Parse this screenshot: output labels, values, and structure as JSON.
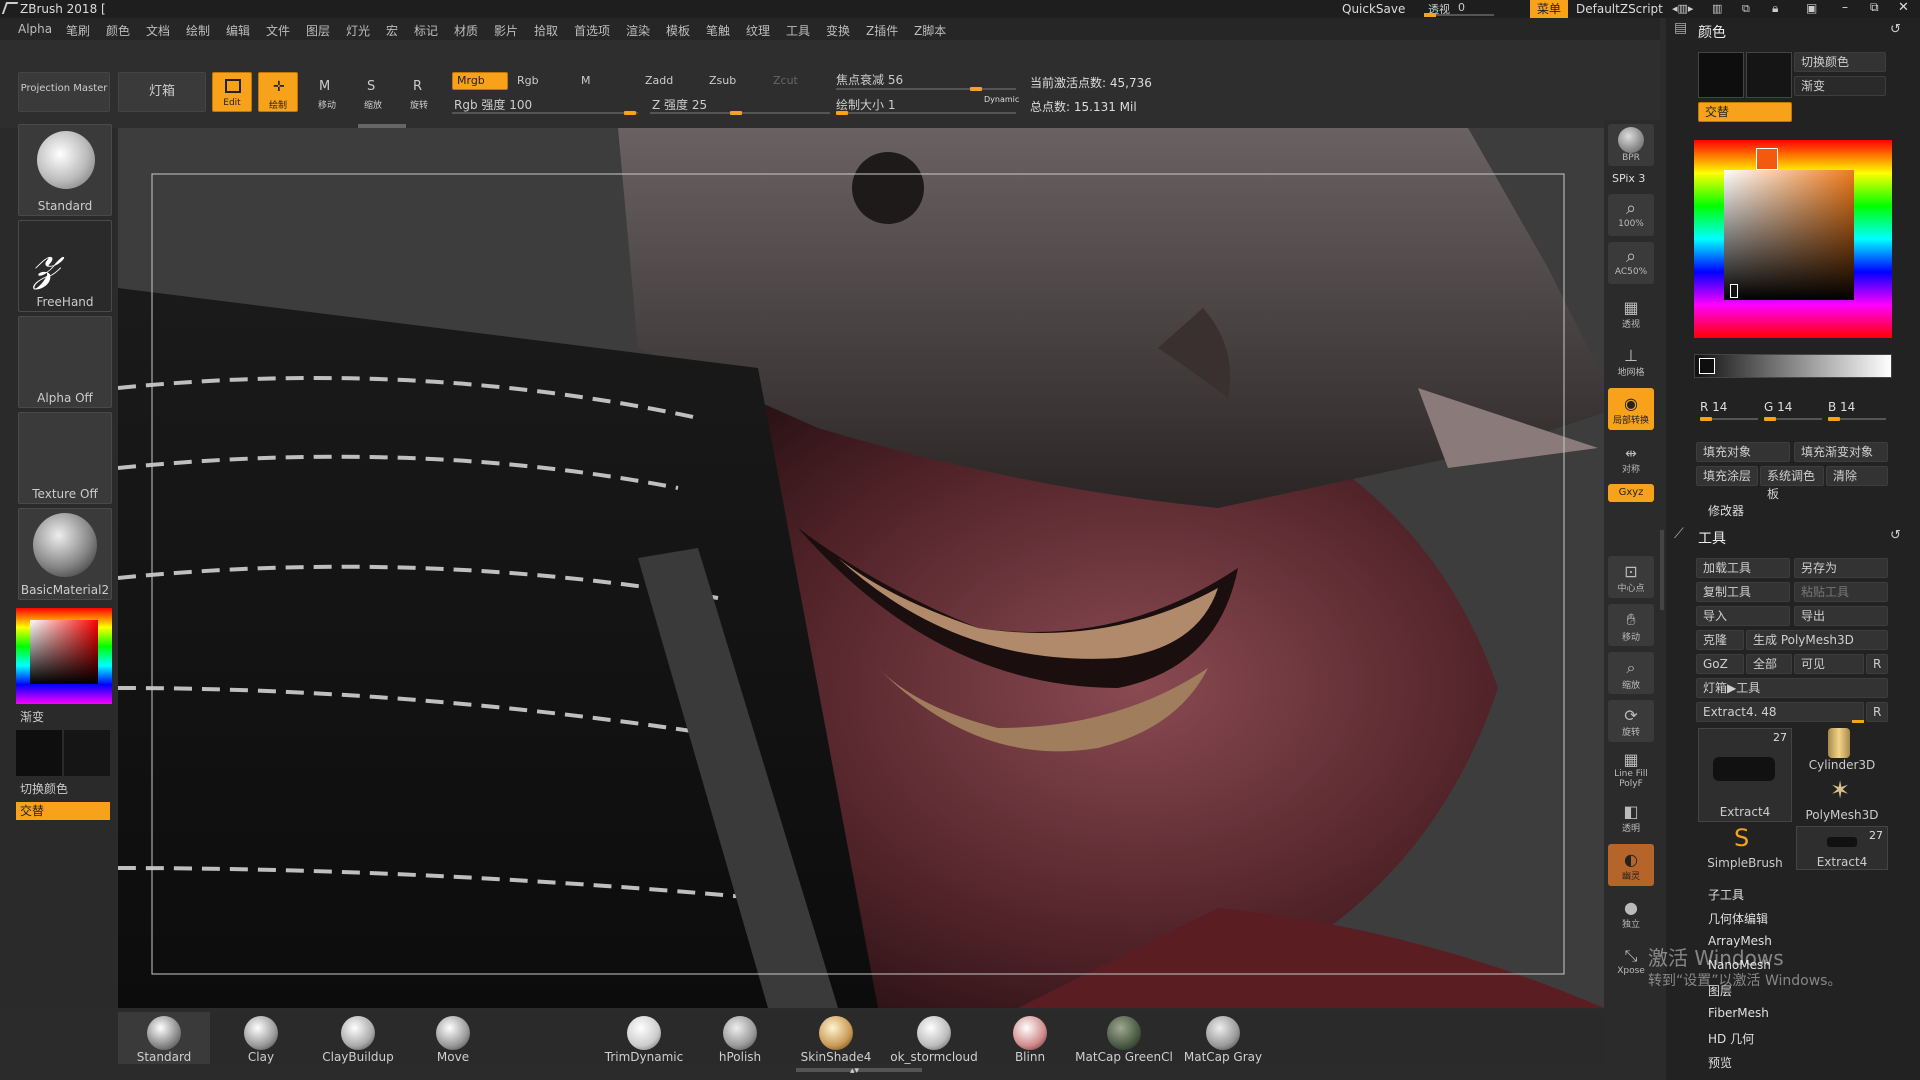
{
  "title_bar": {
    "app_title": "ZBrush 2018 [",
    "quicksave": "QuickSave",
    "transparency_label": "透视",
    "transparency_value": "0",
    "menu_button": "菜单",
    "script_name": "DefaultZScript"
  },
  "menu": [
    "Alpha",
    "笔刷",
    "颜色",
    "文档",
    "绘制",
    "编辑",
    "文件",
    "图层",
    "灯光",
    "宏",
    "标记",
    "材质",
    "影片",
    "拾取",
    "首选项",
    "渲染",
    "模板",
    "笔触",
    "纹理",
    "工具",
    "变换",
    "Z插件",
    "Z脚本"
  ],
  "top_shelf": {
    "projection_master": "Projection Master",
    "lightbox": "灯箱",
    "edit": "Edit",
    "draw": "绘制",
    "move": "移动",
    "scale": "缩放",
    "rotate": "旋转",
    "mrgb": "Mrgb",
    "rgb": "Rgb",
    "m": "M",
    "zadd": "Zadd",
    "zsub": "Zsub",
    "zcut": "Zcut",
    "rgb_intensity": "Rgb 强度 100",
    "z_intensity": "Z 强度 25",
    "focal_shift": "焦点衰减 56",
    "draw_size": "绘制大小 1",
    "dynamic": "Dynamic",
    "active_points": "当前激活点数: 45,736",
    "total_points": "总点数: 15.131 Mil"
  },
  "left_shelf": {
    "brush": "Standard",
    "stroke": "FreeHand",
    "alpha": "Alpha Off",
    "texture": "Texture Off",
    "material": "BasicMaterial2",
    "gradient": "渐变",
    "switch_color": "切换颜色",
    "alternate": "交替"
  },
  "right_shelf": [
    {
      "name": "bpr",
      "label": "BPR"
    },
    {
      "name": "spix",
      "label": "SPix 3"
    },
    {
      "name": "zoom100",
      "label": "100%"
    },
    {
      "name": "ac50",
      "label": "AC50%"
    },
    {
      "name": "persp",
      "label": "透视"
    },
    {
      "name": "floor",
      "label": "地网格"
    },
    {
      "name": "local",
      "label": "局部转换"
    },
    {
      "name": "sym",
      "label": "对称"
    },
    {
      "name": "xyz",
      "label": "Gxyz"
    },
    {
      "name": "frame",
      "label": "中心点"
    },
    {
      "name": "move",
      "label": "移动"
    },
    {
      "name": "scale",
      "label": "缩放"
    },
    {
      "name": "rotate",
      "label": "旋转"
    },
    {
      "name": "polyf",
      "label": "Line Fill PolyF"
    },
    {
      "name": "transp",
      "label": "透明"
    },
    {
      "name": "ghost",
      "label": "幽灵"
    },
    {
      "name": "solo",
      "label": "独立"
    },
    {
      "name": "xpose",
      "label": "Xpose"
    }
  ],
  "bottom_materials": [
    {
      "label": "Standard",
      "color": "#9a9a9a"
    },
    {
      "label": "Clay",
      "color": "#a8a8a8"
    },
    {
      "label": "ClayBuildup",
      "color": "#b4b4b4"
    },
    {
      "label": "Move",
      "color": "#aaaaaa"
    },
    {
      "label": "TrimDynamic",
      "color": "#dcdcdc"
    },
    {
      "label": "hPolish",
      "color": "#b0b0b0"
    },
    {
      "label": "SkinShade4",
      "color": "#d6b57a"
    },
    {
      "label": "ok_stormcloud",
      "color": "#cfcfcf"
    },
    {
      "label": "Blinn",
      "color": "#d8a0a0"
    },
    {
      "label": "MatCap GreenCl",
      "color": "#5a6a55"
    },
    {
      "label": "MatCap Gray",
      "color": "#9c9c9c"
    }
  ],
  "right_panel": {
    "color_title": "颜色",
    "switch_color": "切换颜色",
    "gradient": "渐变",
    "alternate": "交替",
    "r": "R 14",
    "g": "G 14",
    "b": "B 14",
    "fill_object": "填充对象",
    "fill_gradient": "填充渐变对象",
    "fill_layer": "填充涂层",
    "sys_palette": "系统调色板",
    "clear": "清除",
    "modifiers": "修改器",
    "tool_title": "工具",
    "load_tool": "加载工具",
    "save_as": "另存为",
    "copy_tool": "复制工具",
    "paste_tool": "粘贴工具",
    "import": "导入",
    "export": "导出",
    "clone": "克隆",
    "make_polymesh": "生成 PolyMesh3D",
    "goz": "GoZ",
    "all": "全部",
    "visible": "可见",
    "r_btn": "R",
    "lightbox_tool": "灯箱▶工具",
    "extract_slider": "Extract4. 48",
    "tools": [
      {
        "label": "Extract4",
        "count": "27"
      },
      {
        "label": "Cylinder3D",
        "count": ""
      },
      {
        "label": "PolyMesh3D",
        "count": ""
      },
      {
        "label": "SimpleBrush",
        "count": ""
      },
      {
        "label": "Extract4",
        "count": "27"
      }
    ],
    "subpalettes": [
      "子工具",
      "几何体编辑",
      "ArrayMesh",
      "NanoMesh",
      "图层",
      "FiberMesh",
      "HD 几何",
      "预览"
    ]
  },
  "watermark": {
    "line1": "激活 Windows",
    "line2": "转到“设置”以激活 Windows。"
  },
  "colors": {
    "accent": "#f7a21a",
    "bg": "#2b2b2b"
  }
}
